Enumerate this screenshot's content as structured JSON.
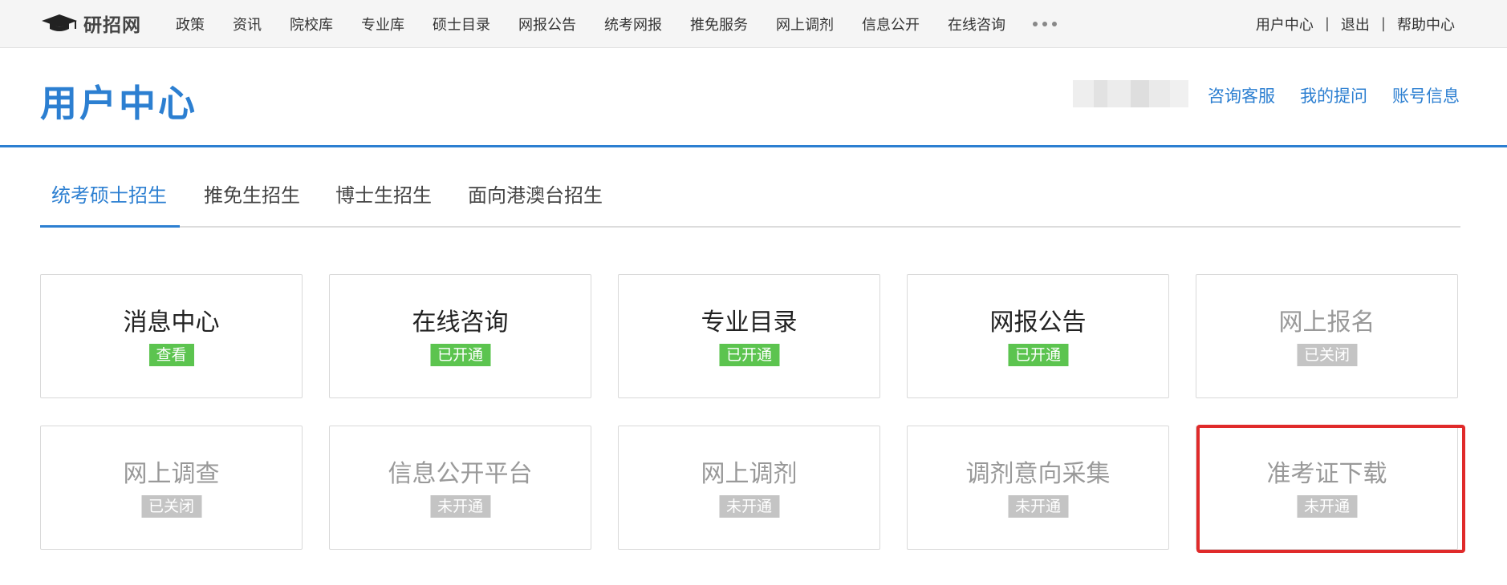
{
  "site": {
    "logo_text": "研招网"
  },
  "nav": {
    "items": [
      "政策",
      "资讯",
      "院校库",
      "专业库",
      "硕士目录",
      "网报公告",
      "统考网报",
      "推免服务",
      "网上调剂",
      "信息公开",
      "在线咨询"
    ]
  },
  "toplinks": {
    "user_center": "用户中心",
    "logout": "退出",
    "help": "帮助中心",
    "separator": "|"
  },
  "header": {
    "title": "用户中心",
    "links": [
      "咨询客服",
      "我的提问",
      "账号信息"
    ]
  },
  "tabs": [
    "统考硕士招生",
    "推免生招生",
    "博士生招生",
    "面向港澳台招生"
  ],
  "cards": [
    {
      "title": "消息中心",
      "badge": "查看",
      "status": "on"
    },
    {
      "title": "在线咨询",
      "badge": "已开通",
      "status": "on"
    },
    {
      "title": "专业目录",
      "badge": "已开通",
      "status": "on"
    },
    {
      "title": "网报公告",
      "badge": "已开通",
      "status": "on"
    },
    {
      "title": "网上报名",
      "badge": "已关闭",
      "status": "off"
    },
    {
      "title": "网上调查",
      "badge": "已关闭",
      "status": "off"
    },
    {
      "title": "信息公开平台",
      "badge": "未开通",
      "status": "off"
    },
    {
      "title": "网上调剂",
      "badge": "未开通",
      "status": "off"
    },
    {
      "title": "调剂意向采集",
      "badge": "未开通",
      "status": "off"
    },
    {
      "title": "准考证下载",
      "badge": "未开通",
      "status": "off"
    }
  ],
  "colors": {
    "accent": "#2c7fd1",
    "badge_on": "#5cc44f",
    "badge_off": "#c4c4c4",
    "highlight": "#e02a2a"
  }
}
